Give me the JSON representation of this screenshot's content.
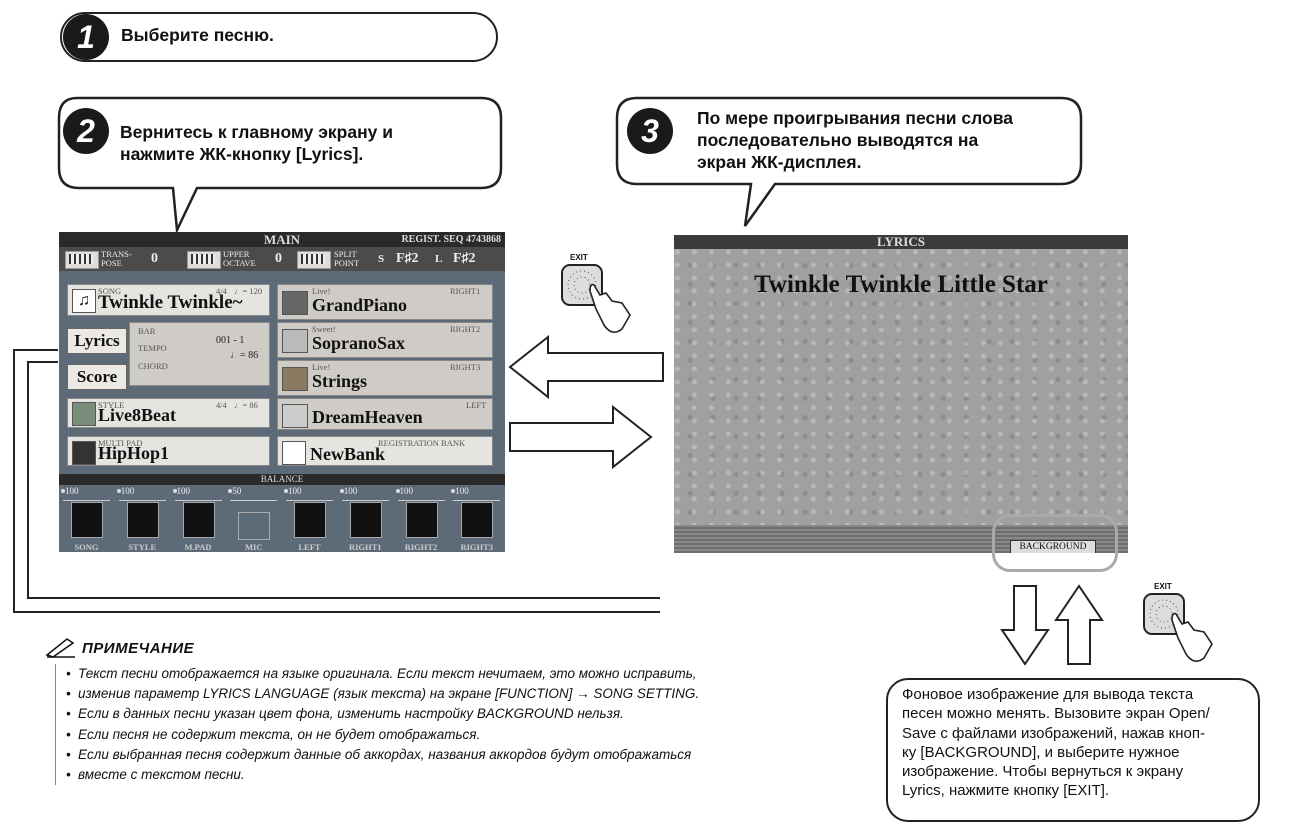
{
  "callouts": {
    "step1": {
      "num": "1",
      "text": "Выберите песню."
    },
    "step2": {
      "num": "2",
      "line1": "Вернитесь к главному экрану и",
      "line2": "нажмите ЖК-кнопку [Lyrics]."
    },
    "step3": {
      "num": "3",
      "line1": "По мере проигрывания песни слова",
      "line2": "последовательно выводятся на",
      "line3": "экран ЖК-дисплея."
    }
  },
  "main_screen": {
    "title": "MAIN",
    "regist": "REGIST. SEQ 4743868",
    "transpose_label1": "TRANS-",
    "transpose_label2": "POSE",
    "transpose_value": "0",
    "upper_label1": "UPPER",
    "upper_label2": "OCTAVE",
    "upper_value": "0",
    "split_label1": "SPLIT",
    "split_label2": "POINT",
    "split_s": "S",
    "split_s_val": "F♯2",
    "split_l": "L",
    "split_l_val": "F♯2",
    "song_label": "SONG",
    "song_meter": "4/4",
    "song_tempo": "♩= 120",
    "song_name": "Twinkle Twinkle~",
    "lyrics_btn": "Lyrics",
    "score_btn": "Score",
    "bar_label": "BAR",
    "bar_value": "001 -   1",
    "tempo_label": "TEMPO",
    "tempo_value": "♩=  86",
    "chord_label": "CHORD",
    "style_label": "STYLE",
    "style_meter": "4/4",
    "style_tempo": "♩=  86",
    "style_name": "Live8Beat",
    "multipad_label": "MULTI PAD",
    "multipad_name": "HipHop1",
    "right1_tag": "Live!",
    "right1_label": "RIGHT1",
    "right1_name": "GrandPiano",
    "right2_tag": "Sweet!",
    "right2_label": "RIGHT2",
    "right2_name": "SopranoSax",
    "right3_tag": "Live!",
    "right3_label": "RIGHT3",
    "right3_name": "Strings",
    "left_label": "LEFT",
    "left_name": "DreamHeaven",
    "regbank_label": "REGISTRATION BANK",
    "regbank_name": "NewBank",
    "balance_label": "BALANCE",
    "mixer": [
      {
        "name": "SONG",
        "value": "100"
      },
      {
        "name": "STYLE",
        "value": "100"
      },
      {
        "name": "M.PAD",
        "value": "100"
      },
      {
        "name": "MIC",
        "value": "50"
      },
      {
        "name": "LEFT",
        "value": "100"
      },
      {
        "name": "RIGHT1",
        "value": "100"
      },
      {
        "name": "RIGHT2",
        "value": "100"
      },
      {
        "name": "RIGHT3",
        "value": "100"
      }
    ]
  },
  "lyrics_screen": {
    "title": "LYRICS",
    "text": "Twinkle Twinkle Little Star",
    "background_btn": "BACKGROUND"
  },
  "exit_label": "EXIT",
  "note": {
    "heading": "ПРИМЕЧАНИЕ",
    "items": [
      "Текст песни отображается на языке оригинала. Если текст нечитаем, это можно исправить,",
      "изменив параметр LYRICS LANGUAGE (язык текста) на экране [FUNCTION] → SONG SETTING.",
      "Если в данных песни указан цвет фона, изменить настройку BACKGROUND нельзя.",
      "Если песня не содержит текста, он не будет отображаться.",
      "Если выбранная песня содержит данные об аккордах, названия аккордов будут отображаться",
      "вместе с текстом песни."
    ]
  },
  "note3": {
    "lines": [
      "Фоновое изображение для вывода текста",
      "песен можно менять. Вызовите экран Open/",
      "Save с файлами изображений, нажав кноп-",
      "ку [BACKGROUND], и выберите нужное",
      "изображение. Чтобы вернуться к экрану",
      "Lyrics, нажмите кнопку [EXIT]."
    ]
  }
}
